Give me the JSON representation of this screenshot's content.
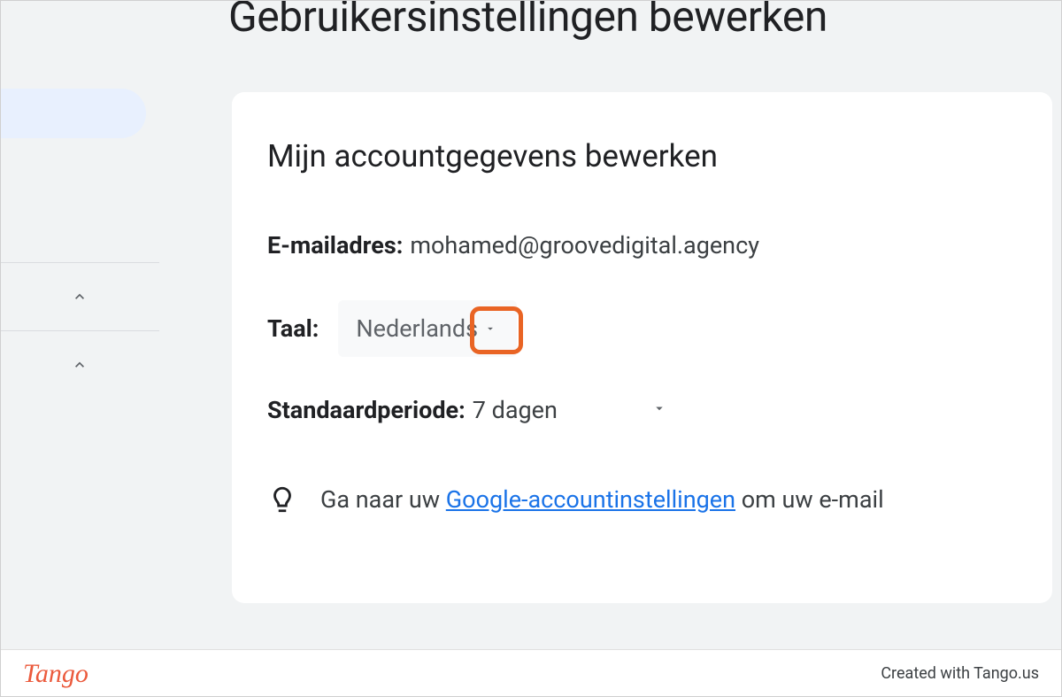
{
  "page": {
    "title": "Gebruikersinstellingen bewerken"
  },
  "card": {
    "title": "Mijn accountgegevens bewerken",
    "email": {
      "label": "E-mailadres:",
      "value": "mohamed@groovedigital.agency"
    },
    "language": {
      "label": "Taal:",
      "value": "Nederlands"
    },
    "period": {
      "label": "Standaardperiode:",
      "value": "7 dagen"
    },
    "hint": {
      "prefix": "Ga naar uw ",
      "link": "Google-accountinstellingen",
      "suffix": " om uw e-mail"
    }
  },
  "footer": {
    "logo": "Tango",
    "credit": "Created with Tango.us"
  }
}
